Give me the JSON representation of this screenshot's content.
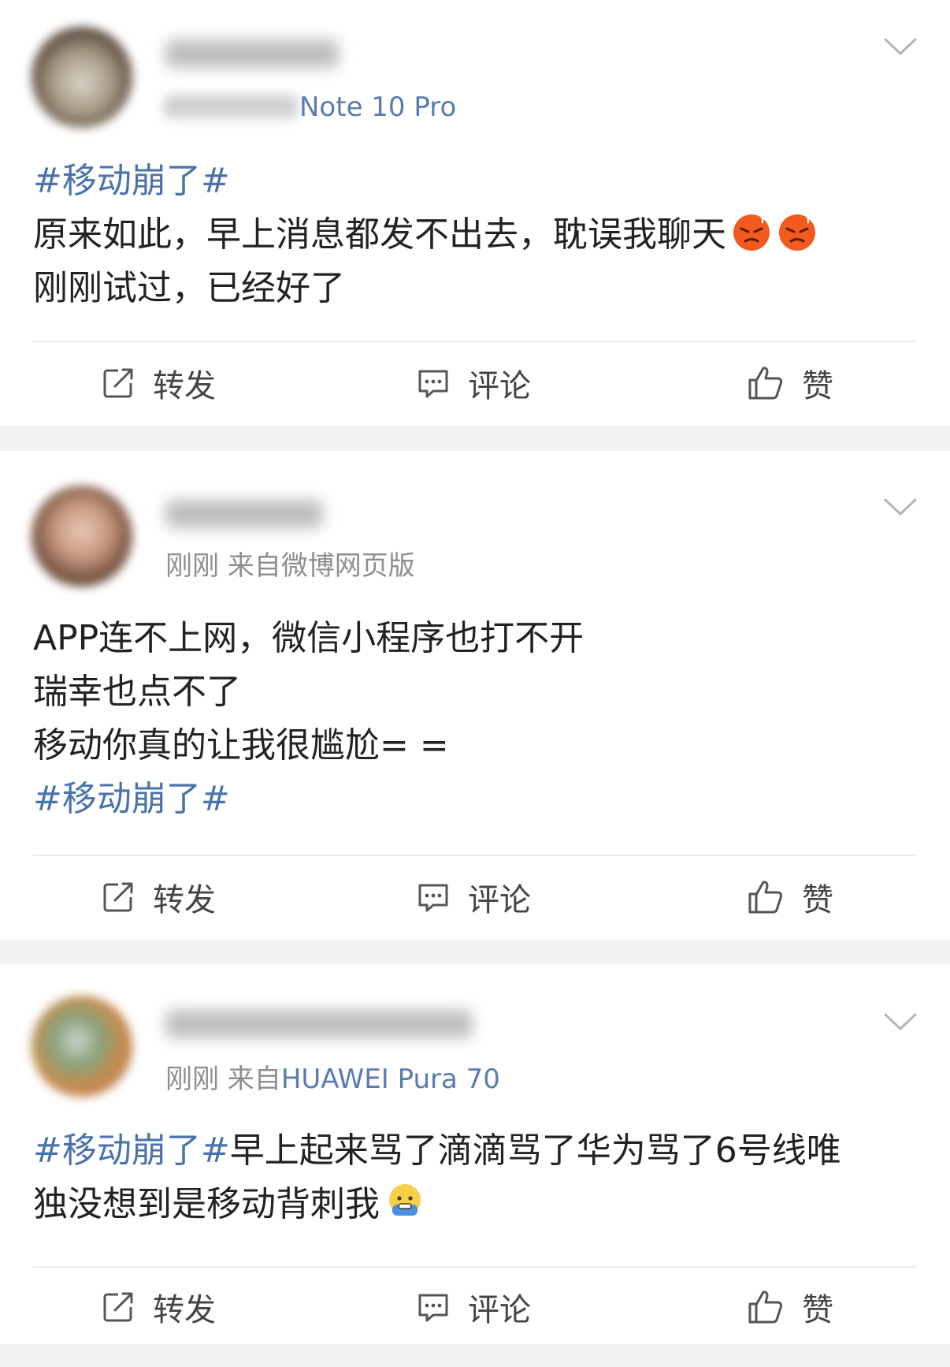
{
  "posts": [
    {
      "meta_prefix": "",
      "meta_source": "Note 10 Pro",
      "lines": [
        {
          "topic": "#移动崩了#",
          "text": ""
        },
        {
          "topic": "",
          "text": "原来如此，早上消息都发不出去，耽误我聊天"
        },
        {
          "topic": "",
          "text": "刚刚试过，已经好了"
        }
      ],
      "emojis": [
        "angry-face-icon",
        "angry-face-icon"
      ],
      "actions": {
        "repost": "转发",
        "comment": "评论",
        "like": "赞"
      }
    },
    {
      "meta_prefix": "刚刚  来自",
      "meta_source": "微博网页版",
      "lines": [
        {
          "topic": "",
          "text": "APP连不上网，微信小程序也打不开"
        },
        {
          "topic": "",
          "text": "瑞幸也点不了"
        },
        {
          "topic": "",
          "text": "移动你真的让我很尴尬= ="
        },
        {
          "topic": "#移动崩了#",
          "text": ""
        }
      ],
      "actions": {
        "repost": "转发",
        "comment": "评论",
        "like": "赞"
      }
    },
    {
      "meta_prefix": "刚刚  来自",
      "meta_source": "HUAWEI Pura 70",
      "lines": [
        {
          "topic": "#移动崩了#",
          "text": "早上起来骂了滴滴骂了华为骂了6号线唯"
        },
        {
          "topic": "",
          "text": "独没想到是移动背刺我"
        }
      ],
      "emojis": [
        "cold-sweat-face-icon"
      ],
      "actions": {
        "repost": "转发",
        "comment": "评论",
        "like": "赞"
      }
    }
  ],
  "colors": {
    "topic": "#4a72ab",
    "source": "#5b7bb0",
    "text": "#222222",
    "meta": "#8e8e8e",
    "background": "#f2f2f2"
  }
}
